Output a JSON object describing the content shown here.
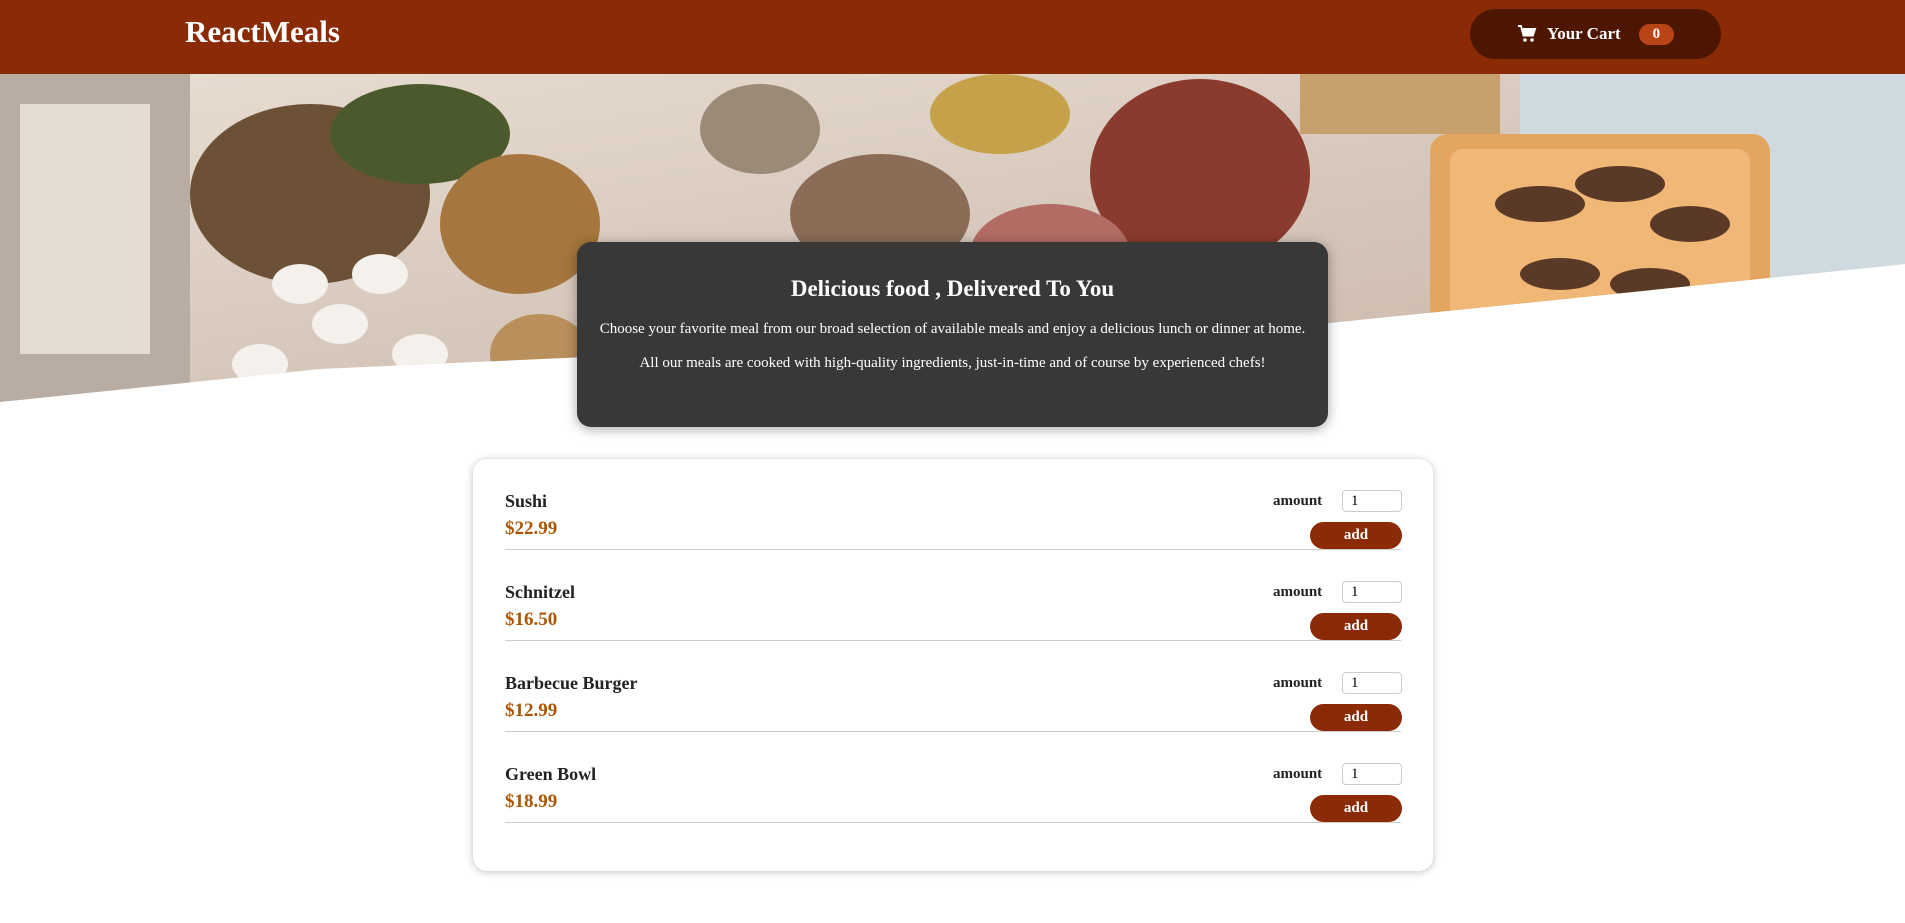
{
  "header": {
    "logo": "ReactMeals",
    "cart_label": "Your Cart",
    "cart_count": "0"
  },
  "hero": {
    "image": "buffet-table-photo"
  },
  "summary": {
    "title": "Delicious food , Delivered To You",
    "p1": "Choose your favorite meal from our broad selection of available meals and enjoy a delicious lunch or dinner at home.",
    "p2": "All our meals are cooked with high-quality ingredients, just-in-time and of course by experienced chefs!"
  },
  "meals": [
    {
      "name": "Sushi",
      "price": "$22.99",
      "amount_label": "amount",
      "amount": "1",
      "add_label": "add"
    },
    {
      "name": "Schnitzel",
      "price": "$16.50",
      "amount_label": "amount",
      "amount": "1",
      "add_label": "add"
    },
    {
      "name": "Barbecue Burger",
      "price": "$12.99",
      "amount_label": "amount",
      "amount": "1",
      "add_label": "add"
    },
    {
      "name": "Green Bowl",
      "price": "$18.99",
      "amount_label": "amount",
      "amount": "1",
      "add_label": "add"
    }
  ],
  "colors": {
    "header_bg": "#8a2b06",
    "cart_bg": "#4d1601",
    "badge_bg": "#b94517",
    "summary_bg": "#383838",
    "price": "#ad5502",
    "add_button": "#8a2b06"
  }
}
